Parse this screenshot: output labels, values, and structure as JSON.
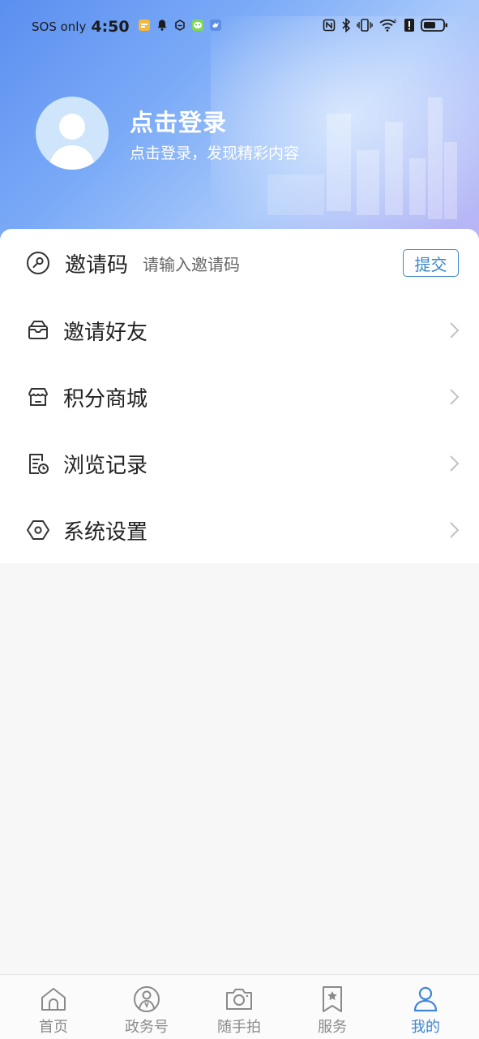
{
  "status_bar": {
    "carrier": "SOS only",
    "time": "4:50"
  },
  "profile": {
    "title": "点击登录",
    "subtitle": "点击登录，发现精彩内容"
  },
  "invite": {
    "label": "邀请码",
    "placeholder": "请输入邀请码",
    "submit_label": "提交"
  },
  "menu": [
    {
      "label": "邀请好友",
      "icon": "mail-icon"
    },
    {
      "label": "积分商城",
      "icon": "store-icon"
    },
    {
      "label": "浏览记录",
      "icon": "history-icon"
    },
    {
      "label": "系统设置",
      "icon": "settings-hexagon-icon"
    }
  ],
  "tabbar": {
    "tabs": [
      {
        "label": "首页",
        "icon": "home-icon"
      },
      {
        "label": "政务号",
        "icon": "government-account-icon"
      },
      {
        "label": "随手拍",
        "icon": "camera-icon"
      },
      {
        "label": "服务",
        "icon": "bookmark-star-icon"
      },
      {
        "label": "我的",
        "icon": "person-icon"
      }
    ],
    "active_index": 4
  },
  "colors": {
    "accent": "#3e86d6",
    "submit_border": "#3b86c9",
    "header_gradient_start": "#5b8ff0",
    "header_gradient_end": "#b9b3f5"
  }
}
